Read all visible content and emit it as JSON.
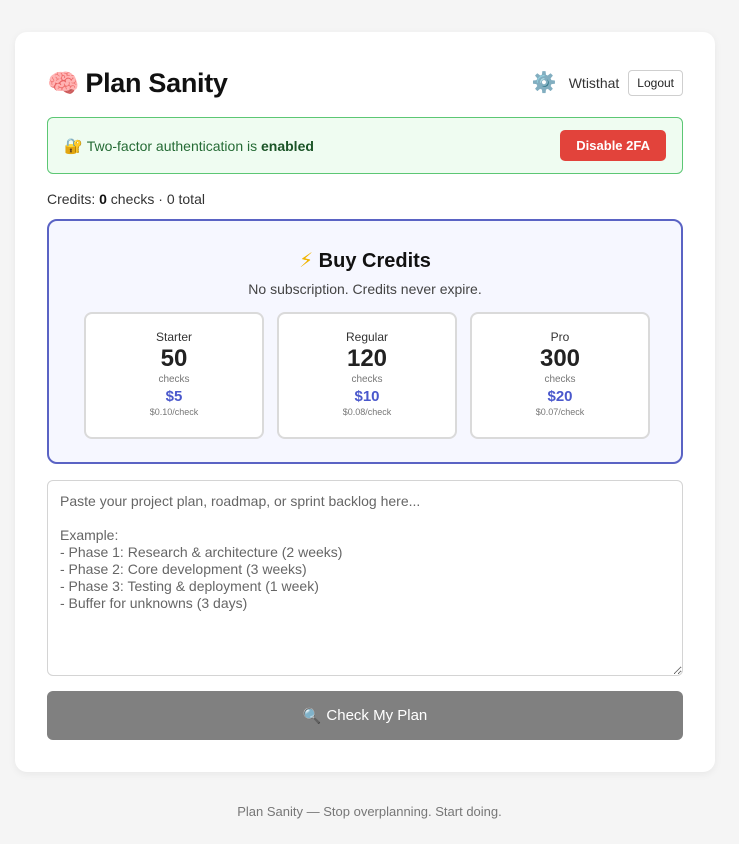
{
  "header": {
    "title_icon": "🧠",
    "title": "Plan Sanity",
    "settings_icon": "⚙️",
    "username": "Wtisthat",
    "logout_label": "Logout"
  },
  "twofa": {
    "icon": "🔐",
    "text_prefix": "Two-factor authentication is ",
    "status": "enabled",
    "disable_label": "Disable 2FA"
  },
  "credits": {
    "prefix": "Credits: ",
    "checks": "0",
    "middle": " checks · ",
    "total": "0 total"
  },
  "buy": {
    "icon": "⚡",
    "title": "Buy Credits",
    "subtitle": "No subscription. Credits never expire.",
    "plans": [
      {
        "name": "Starter",
        "count": "50",
        "unit": "checks",
        "price": "$5",
        "rate": "$0.10/check"
      },
      {
        "name": "Regular",
        "count": "120",
        "unit": "checks",
        "price": "$10",
        "rate": "$0.08/check"
      },
      {
        "name": "Pro",
        "count": "300",
        "unit": "checks",
        "price": "$20",
        "rate": "$0.07/check"
      }
    ]
  },
  "input": {
    "placeholder": "Paste your project plan, roadmap, or sprint backlog here...\n\nExample:\n- Phase 1: Research & architecture (2 weeks)\n- Phase 2: Core development (3 weeks)\n- Phase 3: Testing & deployment (1 week)\n- Buffer for unknowns (3 days)"
  },
  "check": {
    "icon": "🔍",
    "label": "Check My Plan"
  },
  "footer": {
    "text": "Plan Sanity — Stop overplanning. Start doing."
  },
  "colors": {
    "accent": "#5a63c4",
    "success_bg": "#effcf1",
    "success_border": "#5cc774",
    "danger": "#e2433b",
    "price": "#4a58cc",
    "disabled_button": "#808080"
  }
}
